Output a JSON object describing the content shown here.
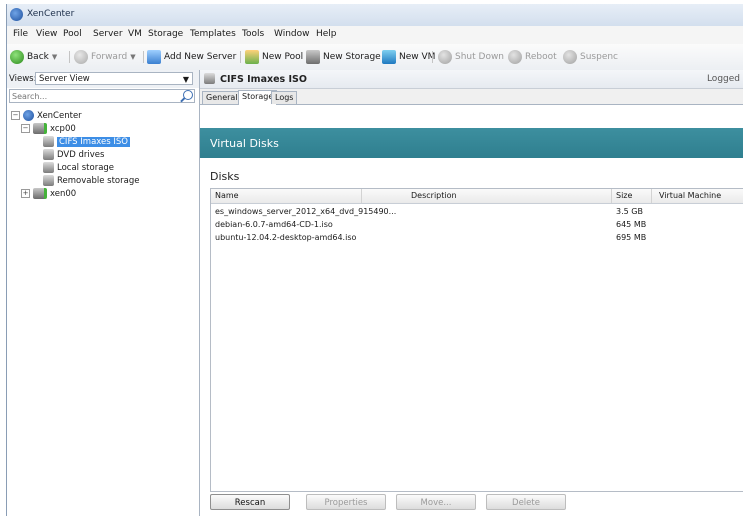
{
  "window": {
    "title": "XenCenter"
  },
  "menu": [
    "File",
    "View",
    "Pool",
    "Server",
    "VM",
    "Storage",
    "Templates",
    "Tools",
    "Window",
    "Help"
  ],
  "toolbar": {
    "back": "Back",
    "forward": "Forward",
    "add_new_server": "Add New Server",
    "new_pool": "New Pool",
    "new_storage": "New Storage",
    "new_vm": "New VM",
    "shut_down": "Shut Down",
    "reboot": "Reboot",
    "suspend": "Suspenc"
  },
  "sidebar": {
    "views_label": "Views:",
    "views_value": "Server View",
    "search_placeholder": "Search...",
    "tree": {
      "root": "XenCenter",
      "host1": "xcp00",
      "storage_items": [
        "CIFS Imaxes ISO",
        "DVD drives",
        "Local storage",
        "Removable storage"
      ],
      "host2": "xen00"
    }
  },
  "main": {
    "object_title": "CIFS Imaxes ISO",
    "logged_in": "Logged",
    "tabs": [
      "General",
      "Storage",
      "Logs"
    ],
    "active_tab": "Storage",
    "banner_title": "Virtual Disks",
    "section_title": "Disks",
    "table": {
      "columns": [
        "Name",
        "Description",
        "Size",
        "Virtual Machine"
      ],
      "rows": [
        {
          "name": "es_windows_server_2012_x64_dvd_915490...",
          "description": "",
          "size": "3.5 GB",
          "vm": ""
        },
        {
          "name": "debian-6.0.7-amd64-CD-1.iso",
          "description": "",
          "size": "645 MB",
          "vm": ""
        },
        {
          "name": "ubuntu-12.04.2-desktop-amd64.iso",
          "description": "",
          "size": "695 MB",
          "vm": ""
        }
      ]
    },
    "buttons": {
      "rescan": "Rescan",
      "properties": "Properties",
      "move": "Move...",
      "delete": "Delete"
    }
  }
}
